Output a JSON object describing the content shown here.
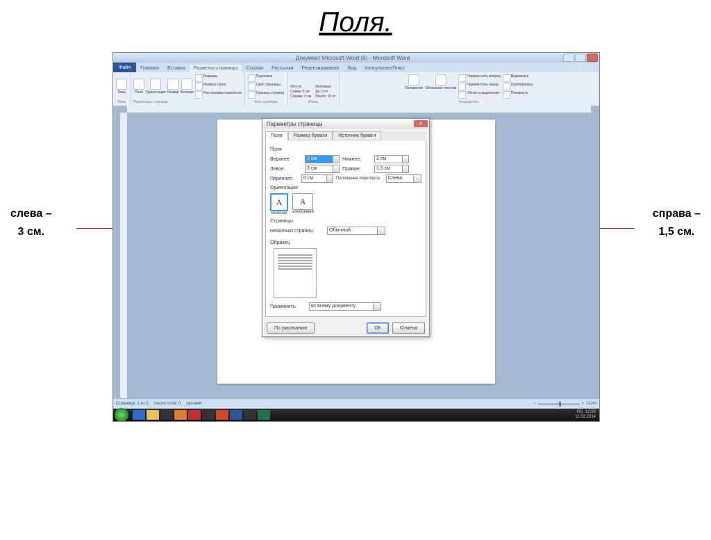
{
  "slide": {
    "title": "Поля.",
    "ann_left_line1": "слева –",
    "ann_left_line2": "3 см.",
    "ann_right_line1": "справа –",
    "ann_right_line2": "1,5 см."
  },
  "window": {
    "title": "Документ Microsoft Word (6) - Microsoft Word",
    "file_tab": "Файл",
    "tabs": [
      "Главная",
      "Вставка",
      "Разметка страницы",
      "Ссылки",
      "Рассылки",
      "Рецензирование",
      "Вид",
      "КонсультантПлюс"
    ],
    "active_tab": 2
  },
  "ribbon": {
    "groups": [
      {
        "name": "Темы",
        "items": [
          "Темы"
        ]
      },
      {
        "name": "Параметры страницы",
        "items": [
          "Поля",
          "Ориентация",
          "Размер",
          "Колонки"
        ],
        "extra": [
          "Разрывы",
          "Номера строк",
          "Расстановка переносов"
        ]
      },
      {
        "name": "Фон страницы",
        "items": [
          "Подложка",
          "Цвет страницы",
          "Границы страниц"
        ]
      },
      {
        "name": "Абзац",
        "items_l": [
          "Отступ",
          "Слева: 0 см",
          "Справа: 0 см"
        ],
        "items_r": [
          "Интервал",
          "До: 0 пт",
          "После: 10 пт"
        ]
      },
      {
        "name": "Упорядочить",
        "items": [
          "Положение",
          "Обтекание текстом"
        ],
        "extra": [
          "Переместить вперед",
          "Переместить назад",
          "Область выделения",
          "Выровнять",
          "Группировать",
          "Повернуть"
        ]
      }
    ]
  },
  "dialog": {
    "title": "Параметры страницы",
    "tabs": [
      "Поля",
      "Размер бумаги",
      "Источник бумаги"
    ],
    "active_tab": 0,
    "section_fields": "Поля",
    "fields": {
      "top_label": "Верхнее:",
      "top_value": "2 см",
      "bottom_label": "Нижнее:",
      "bottom_value": "2 см",
      "left_label": "Левое:",
      "left_value": "3 см",
      "right_label": "Правое:",
      "right_value": "1,5 см",
      "gutter_label": "Переплет:",
      "gutter_value": "0 см",
      "gutter_pos_label": "Положение переплета:",
      "gutter_pos_value": "Слева"
    },
    "orientation_label": "Ориентация",
    "orientation": {
      "portrait": "книжная",
      "landscape": "альбомная"
    },
    "pages_label": "Страницы",
    "pages_field": "несколько страниц:",
    "pages_value": "Обычный",
    "preview_label": "Образец",
    "apply_label": "Применить:",
    "apply_value": "ко всему документу",
    "default_btn": "По умолчанию",
    "ok_btn": "ОК",
    "cancel_btn": "Отмена"
  },
  "status": {
    "page": "Страница: 2 из 2",
    "words": "Число слов: 0",
    "lang": "русский",
    "zoom": "110%"
  },
  "tray": {
    "lang": "RU",
    "time": "12:00",
    "date": "11.02.2014"
  }
}
